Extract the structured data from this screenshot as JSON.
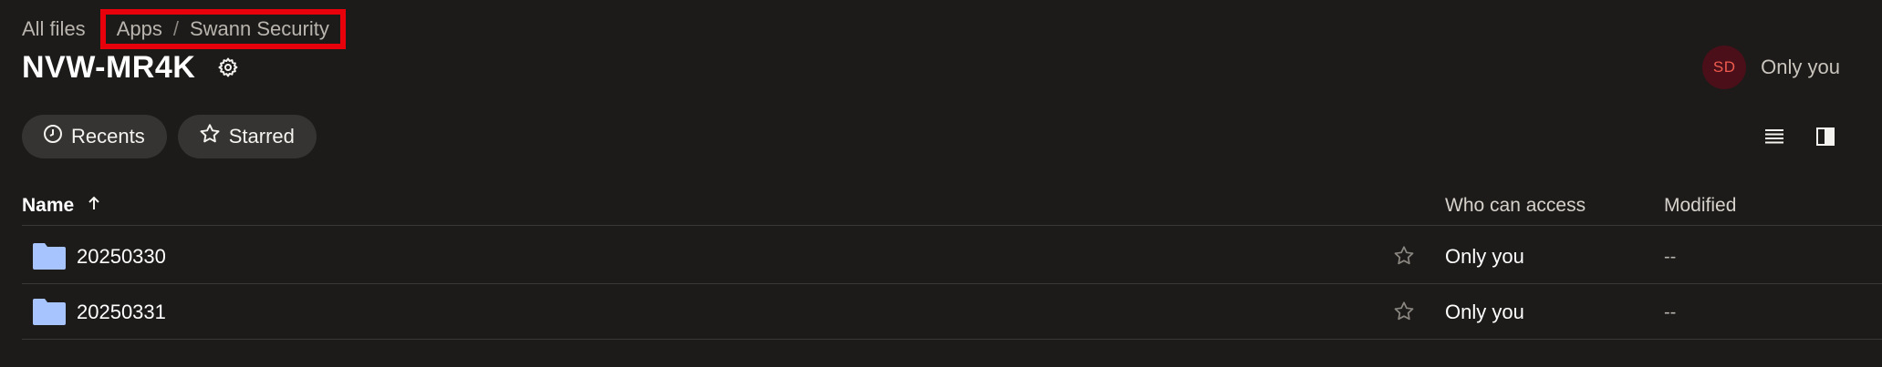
{
  "breadcrumb": {
    "root": "All files",
    "items": [
      "Apps",
      "Swann Security"
    ],
    "separator": "/",
    "highlight_color": "#e8000b"
  },
  "page": {
    "title": "NVW-MR4K",
    "settings_icon": "gear-icon"
  },
  "sharing": {
    "avatar_initials": "SD",
    "avatar_bg": "#4a0f18",
    "avatar_fg": "#ef5b4f",
    "label": "Only you"
  },
  "filters": [
    {
      "label": "Recents",
      "icon": "clock-icon"
    },
    {
      "label": "Starred",
      "icon": "star-icon"
    }
  ],
  "view_controls": [
    {
      "icon": "list-view-icon"
    },
    {
      "icon": "info-panel-icon"
    }
  ],
  "table": {
    "columns": {
      "name": "Name",
      "name_sort": "ascending",
      "access": "Who can access",
      "modified": "Modified"
    },
    "rows": [
      {
        "name": "20250330",
        "type": "folder",
        "access": "Only you",
        "modified": "--",
        "starred": false
      },
      {
        "name": "20250331",
        "type": "folder",
        "access": "Only you",
        "modified": "--",
        "starred": false
      }
    ]
  },
  "colors": {
    "background": "#1c1b1a",
    "folder": "#a7c4ff",
    "pill_bg": "#363432"
  }
}
